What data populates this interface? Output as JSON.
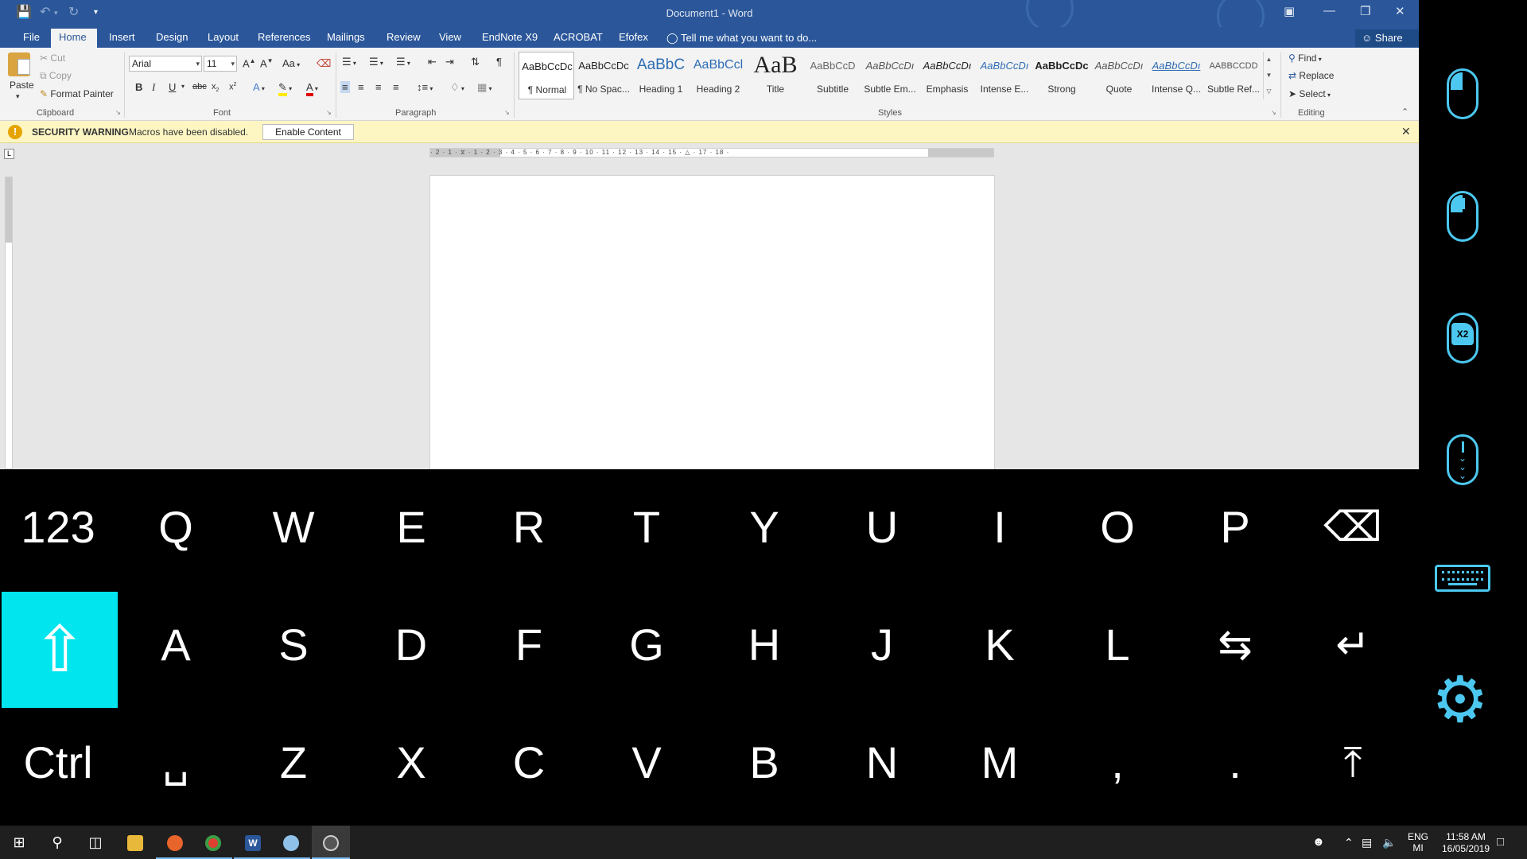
{
  "window": {
    "title": "Document1 - Word",
    "accent_color": "#2b579a"
  },
  "tabs": [
    {
      "label": "File"
    },
    {
      "label": "Home",
      "active": true
    },
    {
      "label": "Insert"
    },
    {
      "label": "Design"
    },
    {
      "label": "Layout"
    },
    {
      "label": "References"
    },
    {
      "label": "Mailings"
    },
    {
      "label": "Review"
    },
    {
      "label": "View"
    },
    {
      "label": "EndNote X9"
    },
    {
      "label": "ACROBAT"
    },
    {
      "label": "Efofex"
    }
  ],
  "tell_me": "Tell me what you want to do...",
  "share": "Share",
  "clipboard": {
    "paste": "Paste",
    "cut": "Cut",
    "copy": "Copy",
    "format_painter": "Format Painter",
    "group_label": "Clipboard"
  },
  "font": {
    "name": "Arial",
    "size": "11",
    "case_label": "Aa",
    "group_label": "Font"
  },
  "paragraph": {
    "group_label": "Paragraph"
  },
  "styles": {
    "group_label": "Styles",
    "items": [
      {
        "preview": "AaBbCcDc",
        "name": "¶ Normal"
      },
      {
        "preview": "AaBbCcDc",
        "name": "¶ No Spac..."
      },
      {
        "preview": "AaBbC",
        "name": "Heading 1"
      },
      {
        "preview": "AaBbCcl",
        "name": "Heading 2"
      },
      {
        "preview": "AaB",
        "name": "Title"
      },
      {
        "preview": "AaBbCcD",
        "name": "Subtitle"
      },
      {
        "preview": "AaBbCcDı",
        "name": "Subtle Em..."
      },
      {
        "preview": "AaBbCcDı",
        "name": "Emphasis"
      },
      {
        "preview": "AaBbCcDı",
        "name": "Intense E..."
      },
      {
        "preview": "AaBbCcDc",
        "name": "Strong"
      },
      {
        "preview": "AaBbCcDı",
        "name": "Quote"
      },
      {
        "preview": "AaBbCcDı",
        "name": "Intense Q..."
      },
      {
        "preview": "AABBCCDD",
        "name": "Subtle Ref..."
      }
    ]
  },
  "editing": {
    "find": "Find",
    "replace": "Replace",
    "select": "Select",
    "group_label": "Editing"
  },
  "security": {
    "title": "SECURITY WARNING",
    "message": "Macros have been disabled.",
    "button": "Enable Content"
  },
  "ruler": {
    "ticks": "· 2 · 1 · ⧖ · 1 · 2 · 3 · 4 · 5 · 6 · 7 · 8 · 9 · 10 · 11 · 12 · 13 · 14 · 15 · △ · 17 · 18 ·",
    "corner": "L"
  },
  "keyboard": {
    "row1": [
      "123",
      "Q",
      "W",
      "E",
      "R",
      "T",
      "Y",
      "U",
      "I",
      "O",
      "P",
      "⌫"
    ],
    "row2": [
      "⇧",
      "A",
      "S",
      "D",
      "F",
      "G",
      "H",
      "J",
      "K",
      "L",
      "⇆",
      "↵"
    ],
    "row3": [
      "Ctrl",
      "␣",
      "Z",
      "X",
      "C",
      "V",
      "B",
      "N",
      "M",
      ",",
      ".",
      "⤒"
    ],
    "active_color": "#00e5ee"
  },
  "side_panel": {
    "x2_label": "X2",
    "icon_color": "#4cc8f0",
    "icons": [
      "left-click-icon",
      "right-click-icon",
      "double-click-icon",
      "scroll-icon",
      "keyboard-icon",
      "settings-icon"
    ]
  },
  "taskbar": {
    "language": "ENG",
    "language_sub": "MI",
    "time": "11:58 AM",
    "date": "16/05/2019"
  }
}
